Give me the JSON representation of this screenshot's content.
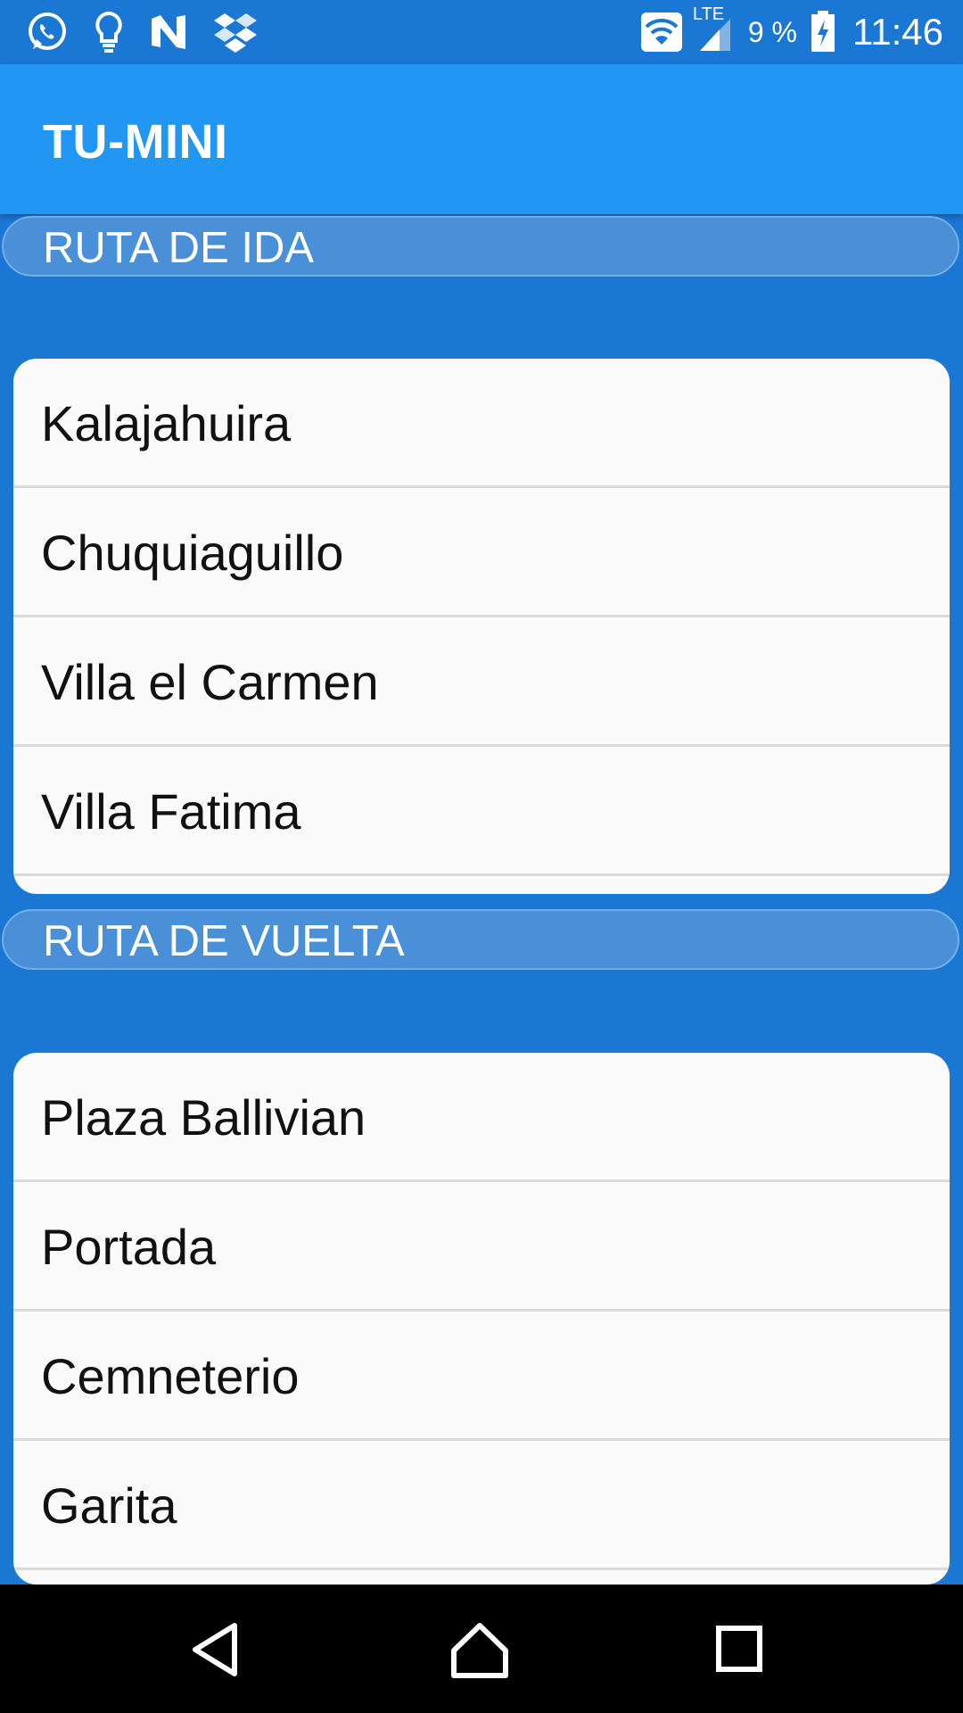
{
  "status_bar": {
    "icons_left": [
      "whatsapp-icon",
      "lightbulb-icon",
      "n-app-icon",
      "dropbox-like-icon"
    ],
    "network_label": "LTE",
    "battery_percent": "9 %",
    "time": "11:46"
  },
  "app_bar": {
    "title": "TU-MINI"
  },
  "sections": [
    {
      "header": "RUTA DE IDA",
      "items": [
        "Kalajahuira",
        "Chuquiaguillo",
        "Villa el Carmen",
        "Villa Fatima"
      ]
    },
    {
      "header": "RUTA DE VUELTA",
      "items": [
        "Plaza Ballivian",
        "Portada",
        "Cemneterio",
        "Garita"
      ]
    }
  ],
  "nav_bar": {
    "buttons": [
      "back-icon",
      "home-icon",
      "recents-icon"
    ]
  },
  "colors": {
    "status_bar": "#1b77d4",
    "app_bar": "#2196f3",
    "background": "#1b77d4",
    "section_header": "#4a90d9",
    "card": "#fafafa",
    "nav_bar": "#000000"
  }
}
